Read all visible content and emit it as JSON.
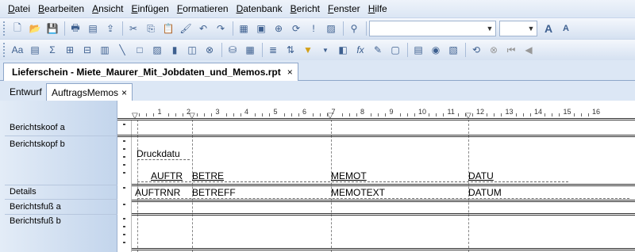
{
  "menu": [
    "Datei",
    "Bearbeiten",
    "Ansicht",
    "Einfügen",
    "Formatieren",
    "Datenbank",
    "Bericht",
    "Fenster",
    "Hilfe"
  ],
  "menu_underline": [
    "D",
    "B",
    "A",
    "E",
    "F",
    "D",
    "B",
    "F",
    "H"
  ],
  "document_tab": {
    "label": "Lieferschein - Miete_Maurer_Mit_Jobdaten_und_Memos.rpt",
    "close": "×"
  },
  "subtabs": {
    "design": "Entwurf",
    "preview": "AuftragsMemos",
    "close": "×"
  },
  "toolbar": {
    "font_combo_value": "",
    "size_combo_value": "",
    "grow_font": "A",
    "shrink_font": "A"
  },
  "sections": [
    {
      "name": "Berichtskoof a"
    },
    {
      "name": "Berichtskopf b"
    },
    {
      "name": "Details"
    },
    {
      "name": "Berichtsfuß a"
    },
    {
      "name": "Berichtsfuß b"
    }
  ],
  "ruler": {
    "labels": [
      "1",
      "2",
      "3",
      "4",
      "5",
      "6",
      "7",
      "8",
      "9",
      "10",
      "11",
      "12",
      "13",
      "14",
      "15",
      "16"
    ]
  },
  "fields": {
    "druckdatum": "Druckdatu",
    "auftr_header": "AUFTR",
    "betre_header": "BETRE",
    "memot_header": "MEMOT",
    "datu_header": "DATU",
    "auftrnr": "AUFTRNR",
    "betreff": "BETREFF",
    "memotext": "MEMOTEXT",
    "datum": "DATUM"
  },
  "colors": {
    "accent": "#3d5f8f",
    "field_marker": "#c0392b"
  }
}
